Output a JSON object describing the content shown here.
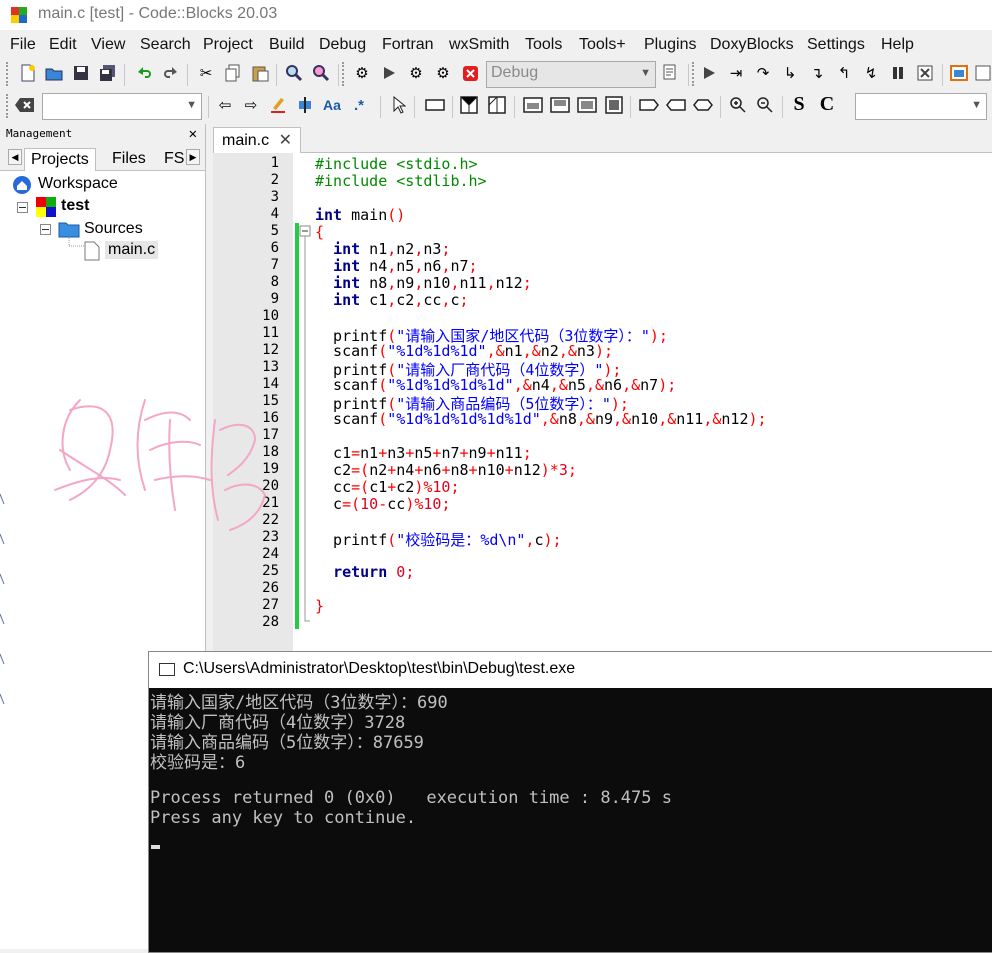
{
  "window": {
    "title": "main.c [test] - Code::Blocks 20.03"
  },
  "menu": [
    "File",
    "Edit",
    "View",
    "Search",
    "Project",
    "Build",
    "Debug",
    "Fortran",
    "wxSmith",
    "Tools",
    "Tools+",
    "Plugins",
    "DoxyBlocks",
    "Settings",
    "Help"
  ],
  "toolbar": {
    "build_target": "Debug",
    "symbol_search": "",
    "function_search": ""
  },
  "management": {
    "title": "Management",
    "tabs": [
      "Projects",
      "Files",
      "FS"
    ],
    "tree": {
      "workspace": "Workspace",
      "project": "test",
      "folder": "Sources",
      "file": "main.c"
    }
  },
  "editor": {
    "tab": "main.c",
    "line_numbers": [
      "1",
      "2",
      "3",
      "4",
      "5",
      "6",
      "7",
      "8",
      "9",
      "10",
      "11",
      "12",
      "13",
      "14",
      "15",
      "16",
      "17",
      "18",
      "19",
      "20",
      "21",
      "22",
      "23",
      "24",
      "25",
      "26",
      "27",
      "28"
    ]
  },
  "console": {
    "title": "C:\\Users\\Administrator\\Desktop\\test\\bin\\Debug\\test.exe",
    "lines": [
      "请输入国家/地区代码（3位数字）：690",
      "请输入厂商代码（4位数字）3728",
      "请输入商品编码（5位数字）：87659",
      "校验码是：6",
      "",
      "Process returned 0 (0x0)   execution time : 8.475 s",
      "Press any key to continue."
    ]
  },
  "colors": {
    "keyword": "#00008b",
    "preprocessor": "#008a00",
    "string": "#0000ff",
    "operator": "#ff0000",
    "changebar": "#22cc44",
    "handwriting": "#f4a6c6"
  }
}
